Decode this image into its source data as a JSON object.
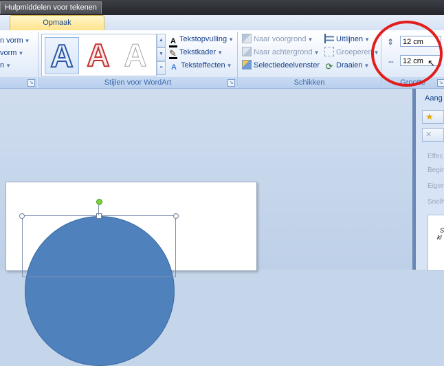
{
  "title_strip": {
    "context_tool": "Hulpmiddelen voor tekenen"
  },
  "tabs": [
    {
      "label": "Opmaak",
      "active": true
    }
  ],
  "ribbon": {
    "left_group": {
      "items": [
        "n vorm",
        "vorm",
        "n"
      ]
    },
    "wordart": {
      "samples": [
        "A",
        "A",
        "A"
      ],
      "commands": {
        "fill": "Tekstopvulling",
        "outline": "Tekstkader",
        "effects": "Teksteffecten"
      },
      "label": "Stijlen voor WordArt"
    },
    "arrange": {
      "commands": {
        "bring_forward": "Naar voorgrond",
        "send_backward": "Naar achtergrond",
        "selection_pane": "Selectiedeelvenster",
        "align": "Uitlijnen",
        "group": "Groeperen",
        "rotate": "Draaien"
      },
      "label": "Schikken"
    },
    "size": {
      "height": "12 cm",
      "width": "12 cm",
      "label": "Grootte"
    }
  },
  "side_pane": {
    "title": "Aang",
    "labels": [
      "Effec",
      "Begin",
      "Eigen",
      "Snelh"
    ],
    "box_text": [
      "S",
      "kl"
    ]
  },
  "colors": {
    "annotation": "#e11d1d",
    "shape_fill": "#4f81bd",
    "accent": "#15428b"
  }
}
